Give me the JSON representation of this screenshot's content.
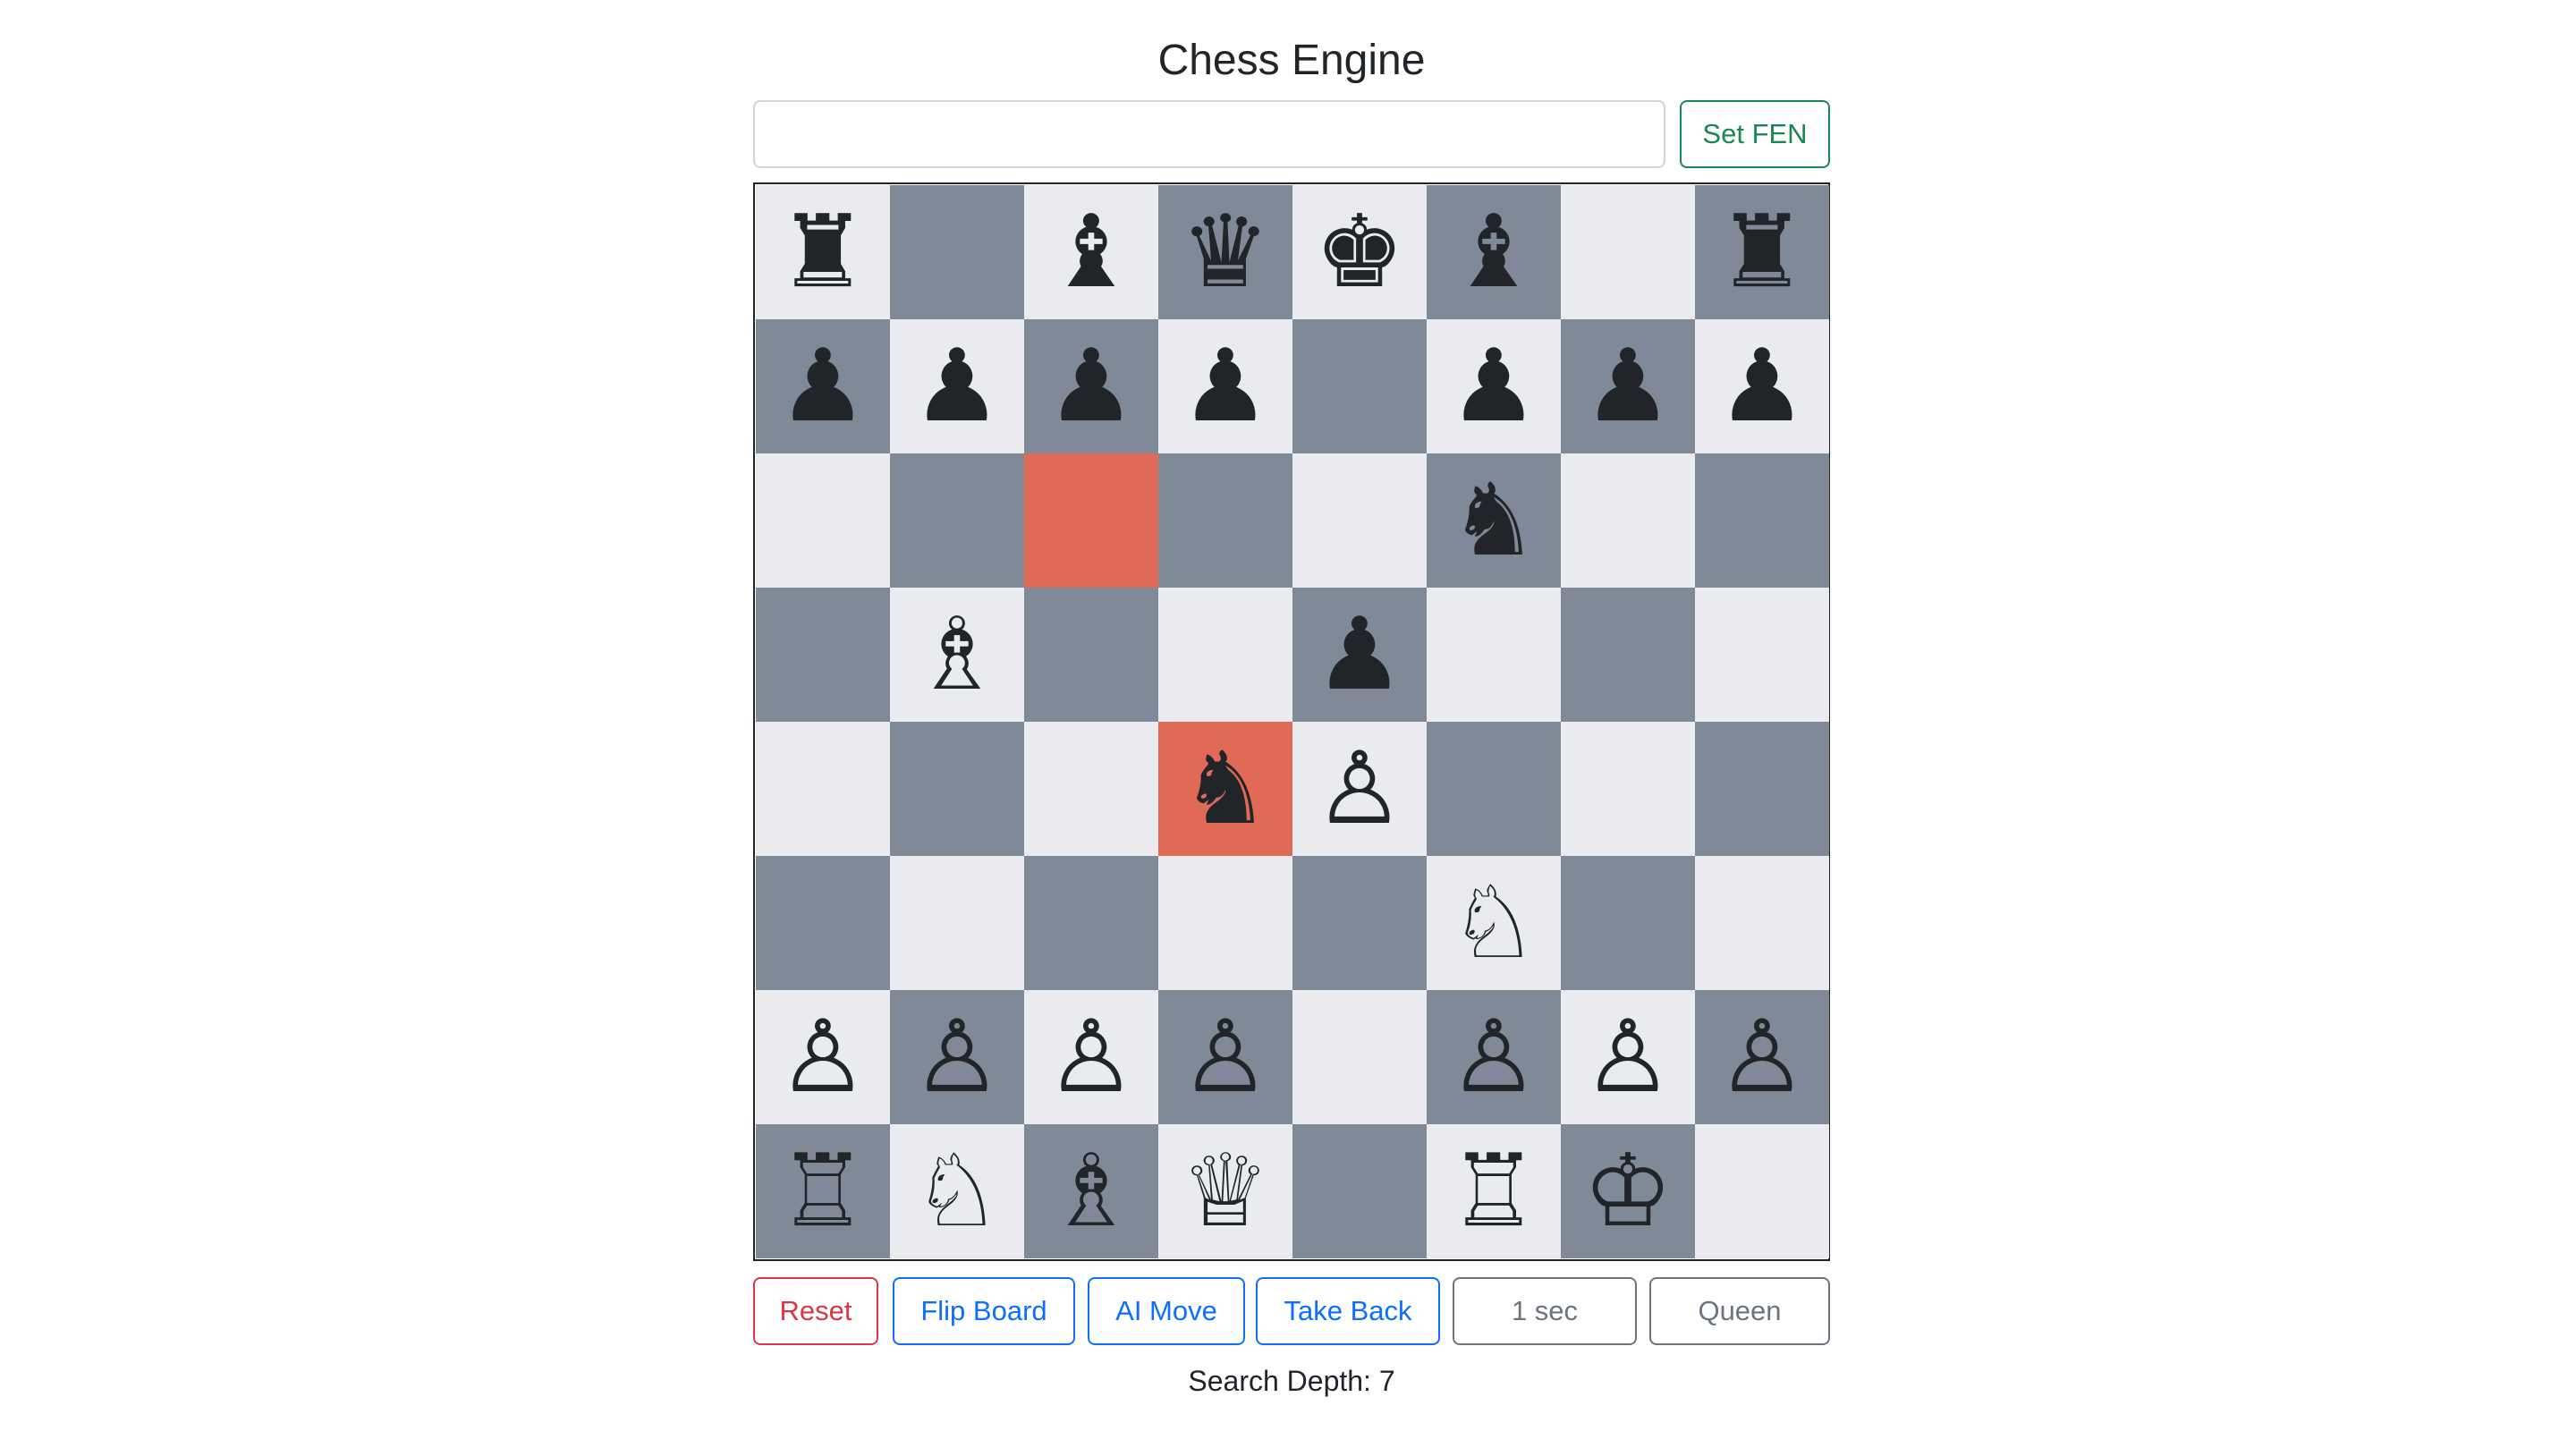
{
  "title": "Chess Engine",
  "fen_input": {
    "value": "",
    "placeholder": ""
  },
  "set_fen_label": "Set FEN",
  "board": {
    "rows": [
      [
        "♜",
        "",
        "♝",
        "♛",
        "♚",
        "♝",
        "",
        "♜"
      ],
      [
        "♟",
        "♟",
        "♟",
        "♟",
        "",
        "♟",
        "♟",
        "♟"
      ],
      [
        "",
        "",
        "",
        "",
        "",
        "♞",
        "",
        ""
      ],
      [
        "",
        "♗",
        "",
        "",
        "♟",
        "",
        "",
        ""
      ],
      [
        "",
        "",
        "",
        "♞",
        "♙",
        "",
        "",
        ""
      ],
      [
        "",
        "",
        "",
        "",
        "",
        "♘",
        "",
        ""
      ],
      [
        "♙",
        "♙",
        "♙",
        "♙",
        "",
        "♙",
        "♙",
        "♙"
      ],
      [
        "♖",
        "♘",
        "♗",
        "♕",
        "",
        "♖",
        "♔",
        ""
      ]
    ],
    "highlighted": [
      [
        2,
        2
      ],
      [
        4,
        3
      ]
    ],
    "colors": {
      "light": "#e9ebee",
      "dark": "#7f8998",
      "highlight": "#e06a55"
    }
  },
  "controls": {
    "reset": "Reset",
    "flip": "Flip Board",
    "ai_move": "AI Move",
    "take_back": "Take Back",
    "time": "1 sec",
    "promotion": "Queen"
  },
  "status": {
    "depth_label": "Search Depth: 7"
  }
}
